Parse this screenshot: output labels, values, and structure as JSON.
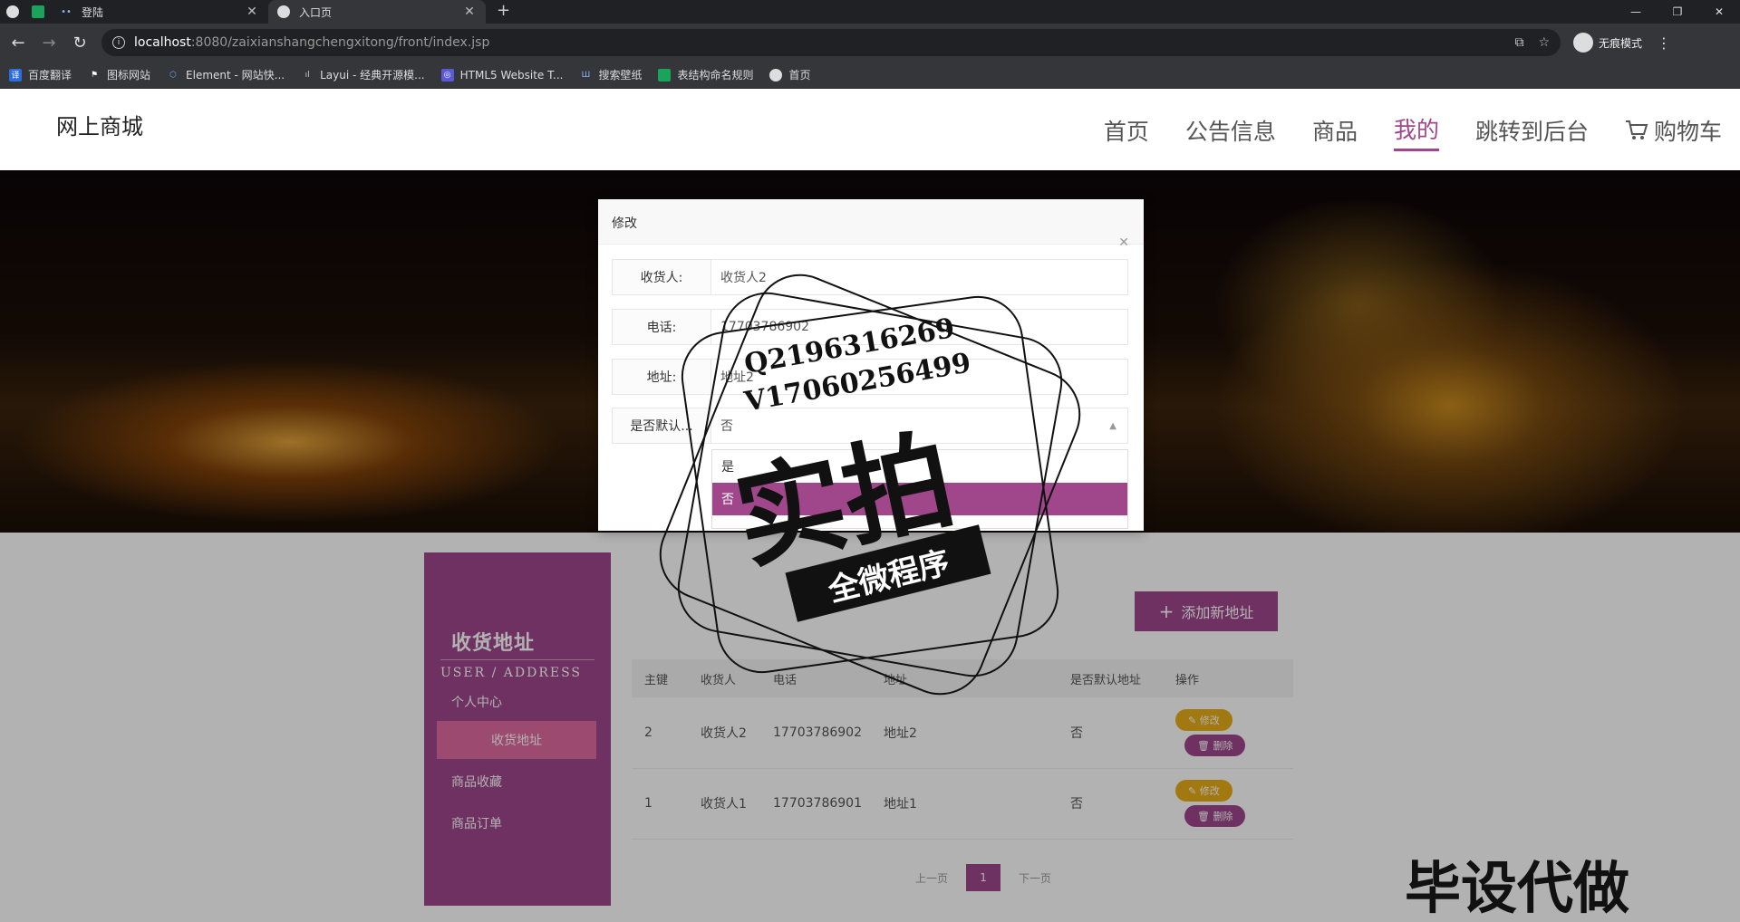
{
  "browser": {
    "tabs": [
      {
        "title": "登陆",
        "active": false
      },
      {
        "title": "入口页",
        "active": true
      }
    ],
    "url_host": "localhost",
    "url_path": ":8080/zaixianshangchengxitong/front/index.jsp",
    "incognito_label": "无痕模式",
    "bookmarks": [
      "百度翻译",
      "图标网站",
      "Element - 网站快...",
      "Layui - 经典开源模...",
      "HTML5 Website T...",
      "搜索壁纸",
      "表结构命名规则",
      "首页"
    ]
  },
  "site": {
    "logo": "网上商城",
    "nav": [
      "首页",
      "公告信息",
      "商品",
      "我的",
      "跳转到后台",
      "购物车"
    ],
    "active_nav": "我的",
    "accent": "#a0478b"
  },
  "sidebar": {
    "title": "收货地址",
    "subtitle": "USER / ADDRESS",
    "items": [
      "个人中心",
      "收货地址",
      "商品收藏",
      "商品订单"
    ],
    "active_item": "收货地址"
  },
  "add_button": "添加新地址",
  "table": {
    "headers": [
      "主键",
      "收货人",
      "电话",
      "地址",
      "是否默认地址",
      "操作"
    ],
    "rows": [
      {
        "id": "2",
        "name": "收货人2",
        "phone": "17703786902",
        "address": "地址2",
        "default": "否"
      },
      {
        "id": "1",
        "name": "收货人1",
        "phone": "17703786901",
        "address": "地址1",
        "default": "否"
      }
    ],
    "edit_label": "修改",
    "delete_label": "删除"
  },
  "pager": {
    "prev": "上一页",
    "current": "1",
    "next": "下一页"
  },
  "modal": {
    "title": "修改",
    "fields": [
      {
        "label": "收货人:",
        "value": "收货人2"
      },
      {
        "label": "电话:",
        "value": "17703786902"
      },
      {
        "label": "地址:",
        "value": "地址2"
      },
      {
        "label": "是否默认...",
        "value": "否"
      }
    ],
    "options": [
      "是",
      "否"
    ],
    "selected_option": "否"
  },
  "watermark": {
    "line1": "Q2196316269",
    "line2": "V17060256499",
    "big": "实拍",
    "ribbon": "全微程序",
    "corner": "毕设代做"
  }
}
